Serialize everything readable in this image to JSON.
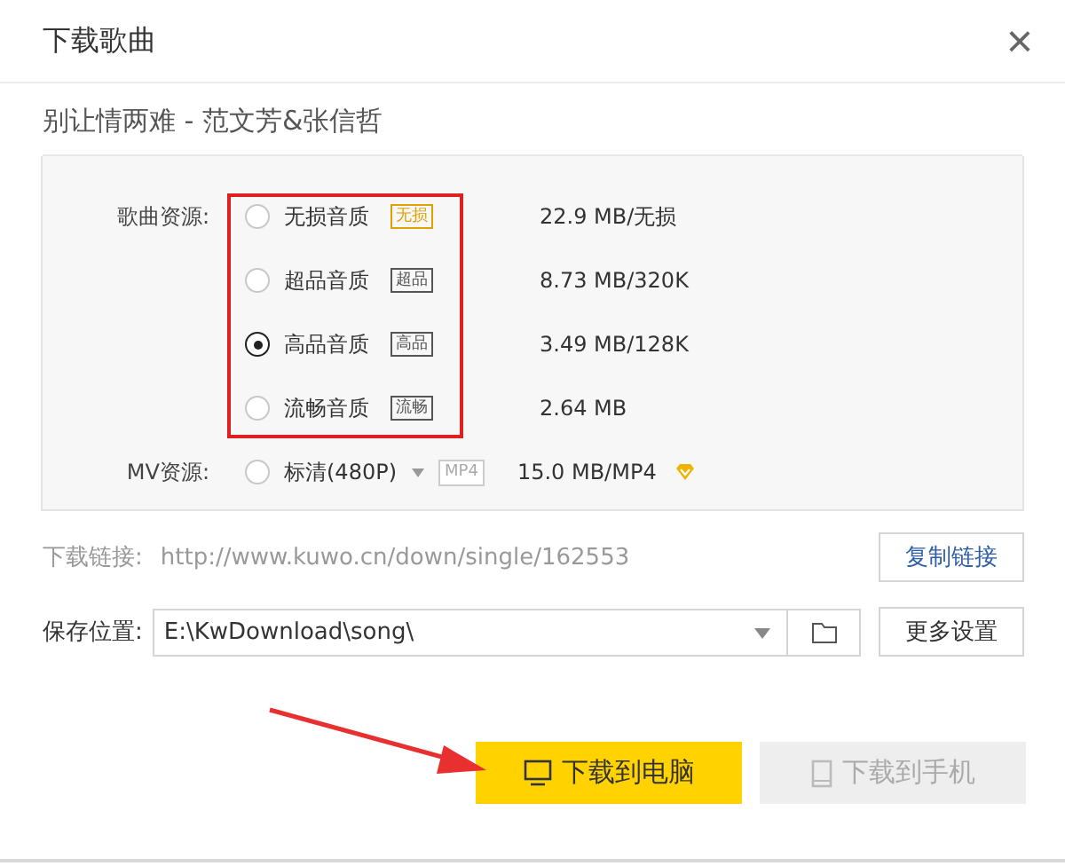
{
  "window": {
    "title": "下载歌曲",
    "close": "×"
  },
  "song": "别让情两难  - 范文芳&张信哲",
  "song_source": {
    "label": "歌曲资源:",
    "options": [
      {
        "name": "无损音质",
        "badge": "无损",
        "color": "#e0a000",
        "size": "22.9  MB/无损",
        "selected": false
      },
      {
        "name": "超品音质",
        "badge": "超品",
        "color": "#555555",
        "size": "8.73 MB/320K",
        "selected": false
      },
      {
        "name": "高品音质",
        "badge": "高品",
        "color": "#555555",
        "size": "3.49 MB/128K",
        "selected": true
      },
      {
        "name": "流畅音质",
        "badge": "流畅",
        "color": "#555555",
        "size": "2.64 MB",
        "selected": false
      }
    ]
  },
  "mv_source": {
    "label": "MV资源:",
    "option": {
      "name": "标清(480P)",
      "selected": false
    },
    "format": "MP4",
    "size": "15.0 MB/MP4",
    "vip": true
  },
  "link": {
    "label": "下载链接:",
    "url": "http://www.kuwo.cn/down/single/162553",
    "button": "复制链接"
  },
  "save": {
    "label": "保存位置:",
    "path": "E:\\KwDownload\\song\\",
    "button": "更多设置"
  },
  "actions": [
    {
      "kind": "computer",
      "label": "下载到电脑",
      "disabled": false
    },
    {
      "kind": "phone",
      "label": "下载到手机",
      "disabled": true
    }
  ]
}
